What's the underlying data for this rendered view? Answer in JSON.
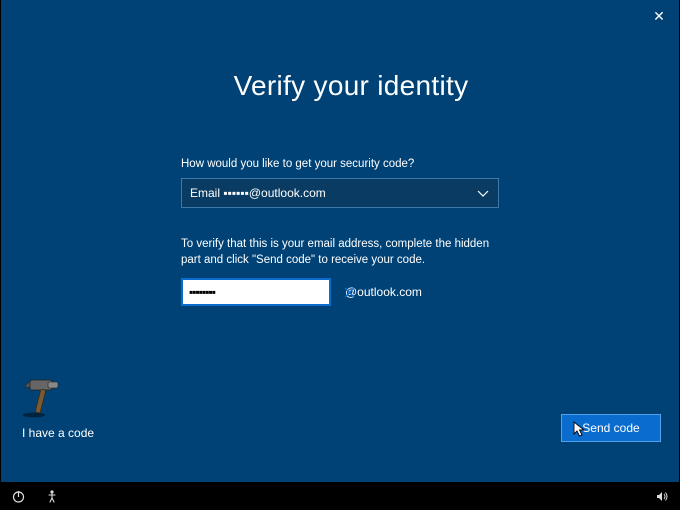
{
  "header": {
    "close_glyph": "✕"
  },
  "main": {
    "heading": "Verify your identity",
    "prompt": "How would you like to get your security code?",
    "select_prefix": "Email ",
    "select_masked": "▪▪▪▪▪▪",
    "select_domain": "@outlook.com",
    "instruction": "To verify that this is your email address, complete the hidden part and click \"Send code\" to receive your code.",
    "email_value": "▪▪▪▪▪▪▪▪",
    "domain_suffix": "@outlook.com"
  },
  "footer": {
    "have_code": "I have a code",
    "send_label": "Send code"
  }
}
